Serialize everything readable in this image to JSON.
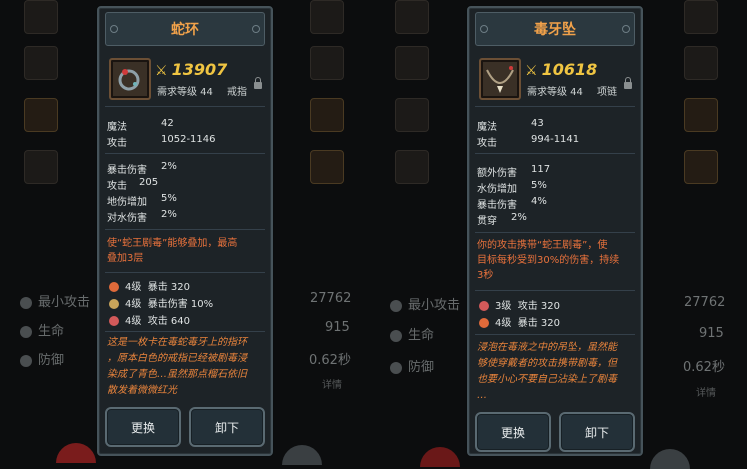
{
  "background": {
    "stats": [
      {
        "label": "最小攻击",
        "value": "27762"
      },
      {
        "label": "生命",
        "value": "915"
      },
      {
        "label": "防御",
        "value": "0.62秒"
      }
    ],
    "detail_label": "详情"
  },
  "left_panel": {
    "title": "蛇环",
    "power": "13907",
    "req": "需求等级 44",
    "slot": "戒指",
    "base_stats": [
      {
        "label": "魔法",
        "value": "42"
      },
      {
        "label": "攻击",
        "value": "1052-1146"
      }
    ],
    "extra_stats": [
      {
        "label": "暴击伤害",
        "value": "2%"
      },
      {
        "label": "攻击",
        "value": "205"
      },
      {
        "label": "地伤增加",
        "value": "5%"
      },
      {
        "label": "对水伤害",
        "value": "2%"
      }
    ],
    "special": [
      "使“蛇王剧毒”能够叠加，最高",
      "叠加3层"
    ],
    "gems": [
      {
        "level": "4级",
        "effect": "暴击 320",
        "color": "#e06a3a"
      },
      {
        "level": "4级",
        "effect": "暴击伤害 10%",
        "color": "#c9a45a"
      },
      {
        "level": "4级",
        "effect": "攻击 640",
        "color": "#d35a5a"
      }
    ],
    "flavor": [
      "这是一枚卡在毒蛇毒牙上的指环",
      "，原本白色的戒指已经被剧毒浸",
      "染成了青色…虽然那点榴石依旧",
      "散发着微微红光"
    ],
    "buttons": {
      "replace": "更换",
      "unequip": "卸下"
    }
  },
  "right_panel": {
    "title": "毒牙坠",
    "power": "10618",
    "req": "需求等级 44",
    "slot": "项链",
    "base_stats": [
      {
        "label": "魔法",
        "value": "43"
      },
      {
        "label": "攻击",
        "value": "994-1141"
      }
    ],
    "extra_stats": [
      {
        "label": "额外伤害",
        "value": "117"
      },
      {
        "label": "水伤增加",
        "value": "5%"
      },
      {
        "label": "暴击伤害",
        "value": "4%"
      },
      {
        "label": "贯穿",
        "value": "2%"
      }
    ],
    "special": [
      "你的攻击携带“蛇王剧毒”，使",
      "目标每秒受到30%的伤害，持续",
      "3秒"
    ],
    "gems": [
      {
        "level": "3级",
        "effect": "攻击 320",
        "color": "#d35a5a"
      },
      {
        "level": "4级",
        "effect": "暴击 320",
        "color": "#e06a3a"
      }
    ],
    "flavor": [
      "浸泡在毒液之中的吊坠，虽然能",
      "够使穿戴者的攻击携带剧毒，但",
      "也要小心不要自己沾染上了剧毒",
      "…"
    ],
    "buttons": {
      "replace": "更换",
      "unequip": "卸下"
    }
  },
  "colors": {
    "title": "#f2a24a",
    "power": "#f0c542",
    "special": "#e9723c",
    "panel_bg": "#1d2327"
  }
}
